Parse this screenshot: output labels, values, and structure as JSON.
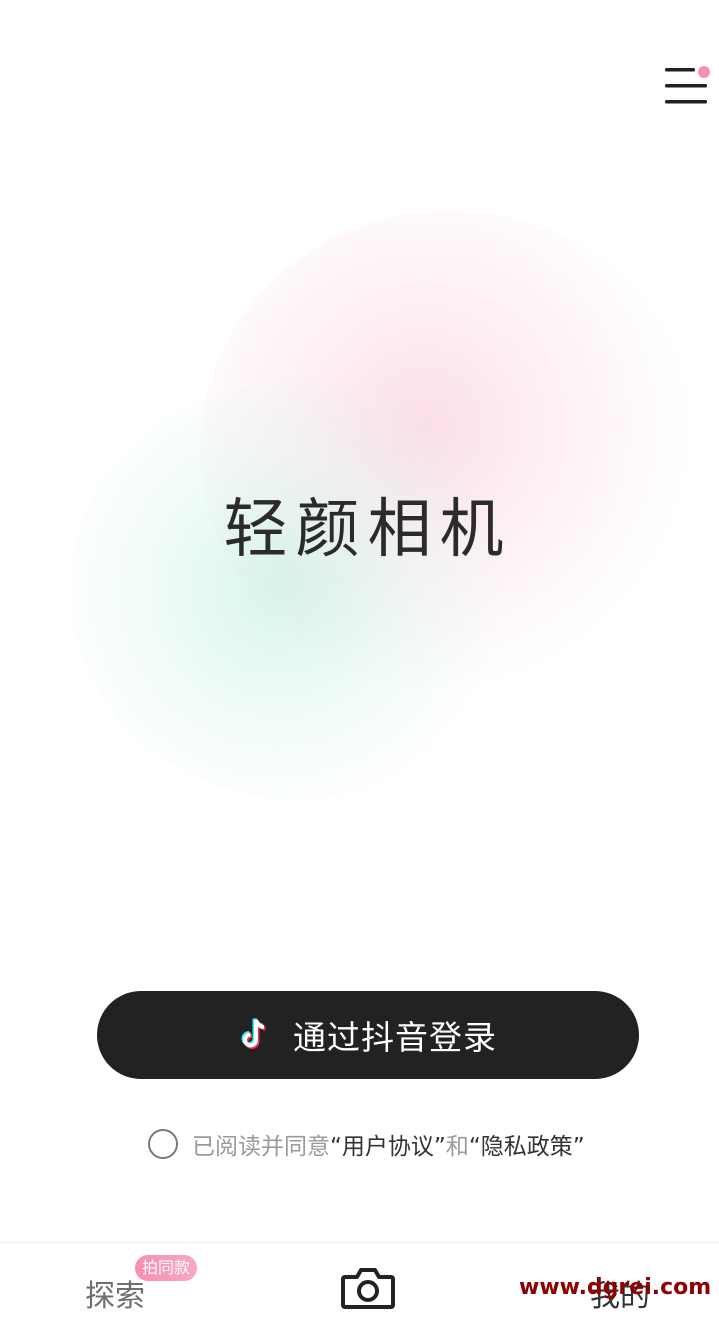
{
  "app": {
    "title": "轻颜相机"
  },
  "menu": {
    "icon": "hamburger-menu-icon",
    "notification_dot_color": "#f58fb3"
  },
  "login": {
    "button_label": "通过抖音登录",
    "icon": "douyin-logo-icon",
    "button_color": "#222222"
  },
  "agreement": {
    "prefix": "已阅读并同意",
    "user_agreement": "“用户协议”",
    "joiner": "和",
    "privacy_policy": "“隐私政策”"
  },
  "tabbar": {
    "explore_label": "探索",
    "explore_badge": "拍同款",
    "camera_icon": "camera-icon",
    "mine_label": "我的"
  },
  "watermark": {
    "text": "www.dgrei.com"
  }
}
